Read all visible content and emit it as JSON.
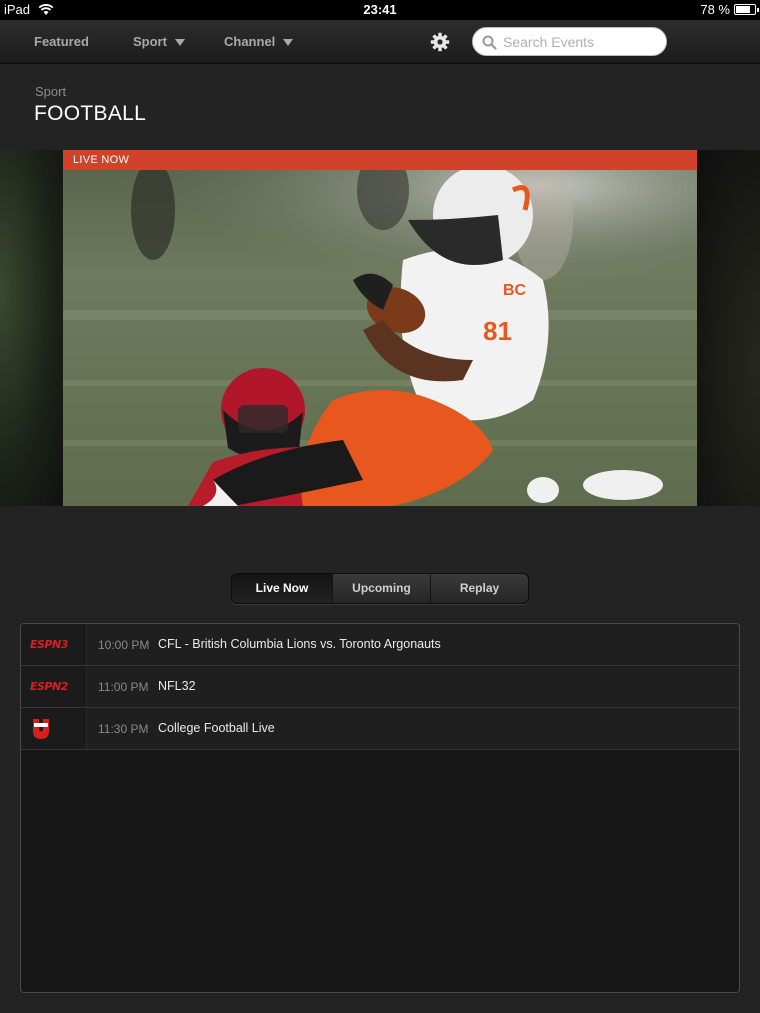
{
  "status_bar": {
    "device": "iPad",
    "time": "23:41",
    "battery": "78 %",
    "battery_level": 0.78
  },
  "nav": {
    "featured": "Featured",
    "sport": "Sport",
    "channel": "Channel",
    "search_placeholder": "Search Events"
  },
  "header": {
    "breadcrumb": "Sport",
    "title": "FOOTBALL"
  },
  "hero": {
    "banner": "LIVE NOW"
  },
  "tabs": [
    "Live Now",
    "Upcoming",
    "Replay"
  ],
  "active_tab": "Live Now",
  "events": [
    {
      "channel_logo": "ESPN3",
      "time": "10:00 PM",
      "title": "CFL - British Columbia Lions vs. Toronto Argonauts"
    },
    {
      "channel_logo": "ESPN2",
      "time": "11:00 PM",
      "title": "NFL32"
    },
    {
      "channel_logo": "ESPNU",
      "time": "11:30 PM",
      "title": "College Football Live"
    }
  ],
  "colors": {
    "accent": "#d0422a",
    "espn_red": "#d81e1e",
    "background": "#232323"
  }
}
